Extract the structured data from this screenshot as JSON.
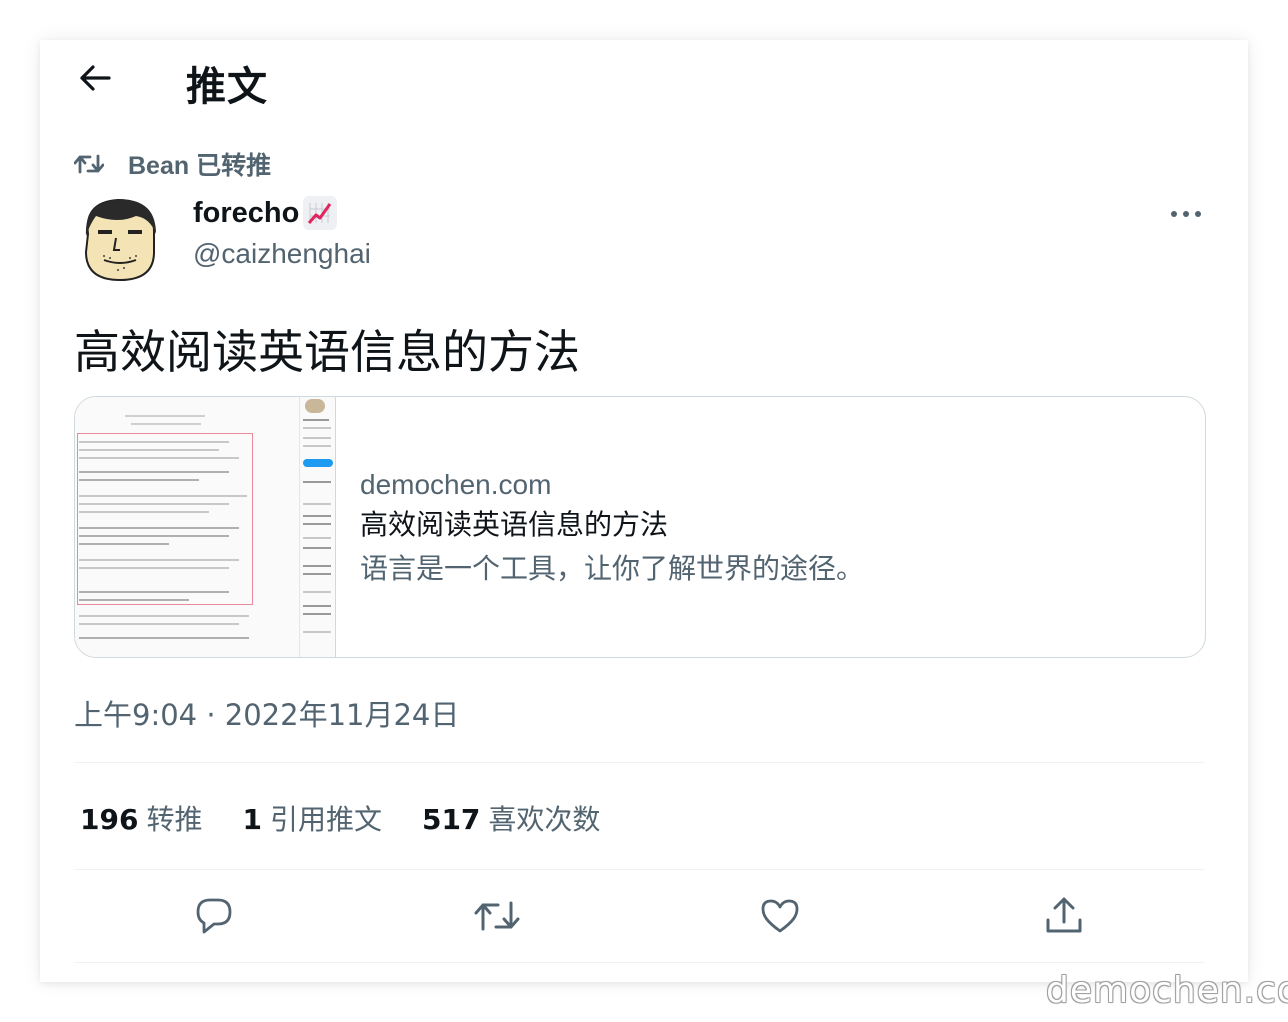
{
  "header": {
    "title": "推文"
  },
  "retweet": {
    "label": "Bean 已转推"
  },
  "author": {
    "display_name": "forecho",
    "handle": "@caizhenghai"
  },
  "tweet": {
    "text": "高效阅读英语信息的方法"
  },
  "link_card": {
    "domain": "demochen.com",
    "title": "高效阅读英语信息的方法",
    "description": "语言是一个工具，让你了解世界的途径。"
  },
  "timestamp": "上午9:04 · 2022年11月24日",
  "stats": [
    {
      "count": "196",
      "label": "转推"
    },
    {
      "count": "1",
      "label": "引用推文"
    },
    {
      "count": "517",
      "label": "喜欢次数"
    }
  ],
  "actions": [
    "reply-icon",
    "retweet-icon",
    "like-icon",
    "share-icon"
  ],
  "watermark": "demochen.com",
  "colors": {
    "text": "#0f1419",
    "secondary": "#536471",
    "border": "#cfd9de",
    "divider": "#eff3f4"
  }
}
